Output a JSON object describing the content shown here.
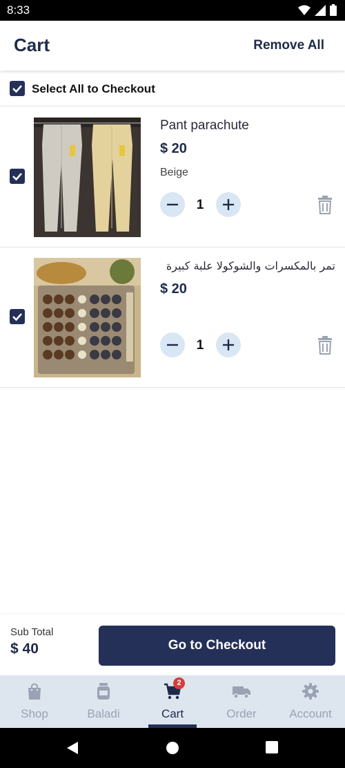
{
  "status_bar": {
    "time": "8:33"
  },
  "header": {
    "title": "Cart",
    "remove_all_label": "Remove All"
  },
  "select_all": {
    "label": "Select All to Checkout",
    "checked": true
  },
  "items": [
    {
      "name": "Pant parachute",
      "price": "$ 20",
      "variant": "Beige",
      "quantity": "1",
      "checked": true,
      "image": "beige-and-grey-parachute-pants"
    },
    {
      "name": "تمر بالمكسرات والشوكولا علبة كبيرة",
      "price": "$ 20",
      "variant": "",
      "quantity": "1",
      "checked": true,
      "image": "dates-with-nuts-and-chocolate-box"
    }
  ],
  "summary": {
    "subtotal_label": "Sub Total",
    "subtotal_value": "$ 40",
    "checkout_label": "Go to Checkout"
  },
  "bottom_nav": {
    "items": [
      {
        "label": "Shop",
        "icon": "shopping-bag-icon"
      },
      {
        "label": "Baladi",
        "icon": "jar-icon"
      },
      {
        "label": "Cart",
        "icon": "cart-icon",
        "badge": "2",
        "active": true
      },
      {
        "label": "Order",
        "icon": "truck-icon"
      },
      {
        "label": "Account",
        "icon": "gear-icon"
      }
    ]
  },
  "colors": {
    "primary": "#243058",
    "nav_background": "#dde5ef",
    "qty_button": "#d9e6f3",
    "badge": "#d93a3a"
  }
}
